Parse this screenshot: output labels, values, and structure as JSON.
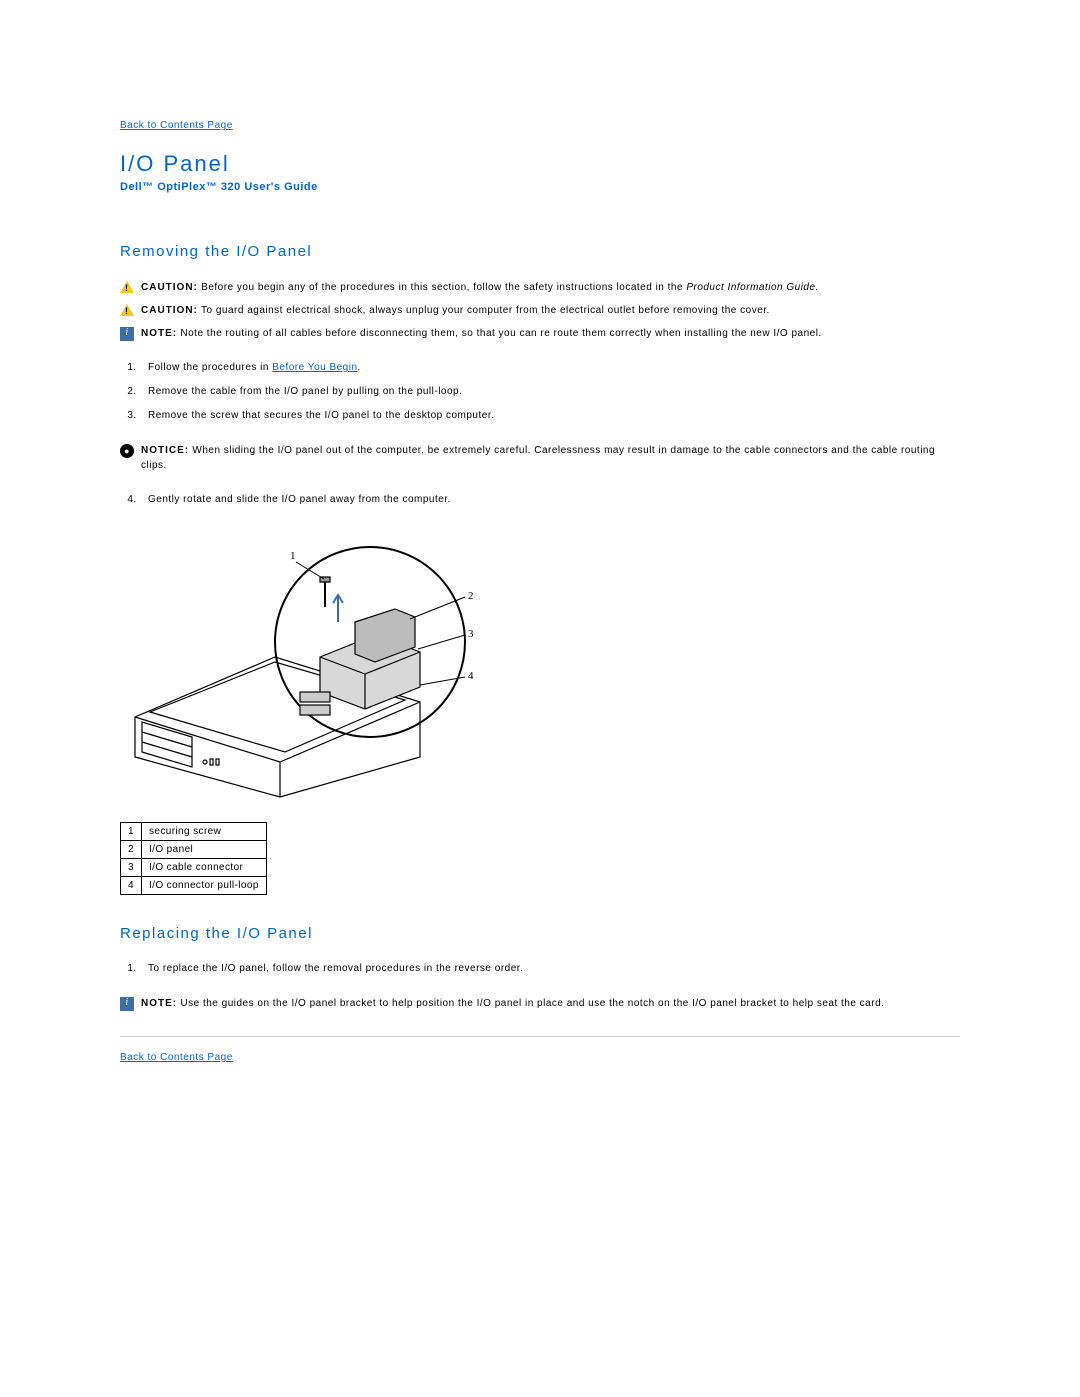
{
  "nav": {
    "back_top": "Back to Contents Page",
    "back_bottom": "Back to Contents Page"
  },
  "title": "I/O Panel",
  "subtitle": "Dell™ OptiPlex™ 320 User's Guide",
  "section1": {
    "heading": "Removing the I/O Panel",
    "caution1_label": "CAUTION:",
    "caution1_text": "Before you begin any of the procedures in this section, follow the safety instructions located in the ",
    "caution1_italic": "Product Information Guide.",
    "caution2_label": "CAUTION:",
    "caution2_text": "To guard against electrical shock, always unplug your computer from the electrical outlet before removing the cover.",
    "note1_label": "NOTE:",
    "note1_text": "Note the routing of all cables before disconnecting them, so that you can re route them correctly when installing the new I/O panel.",
    "step1_a": "Follow the procedures in ",
    "step1_link": "Before You Begin",
    "step1_b": ".",
    "step2": "Remove the cable from the I/O panel by pulling on the pull-loop.",
    "step3": "Remove the screw that secures the I/O panel to the desktop computer.",
    "notice_label": "NOTICE:",
    "notice_text": "When sliding the I/O panel out of the computer, be extremely careful. Carelessness may result in damage to the cable connectors and the cable routing clips.",
    "step4": "Gently rotate and slide the I/O panel away from the computer.",
    "legend": [
      {
        "n": "1",
        "label": "securing screw"
      },
      {
        "n": "2",
        "label": "I/O panel"
      },
      {
        "n": "3",
        "label": "I/O cable connector"
      },
      {
        "n": "4",
        "label": "I/O connector pull-loop"
      }
    ]
  },
  "section2": {
    "heading": "Replacing the I/O Panel",
    "step1": "To replace the I/O panel, follow the removal procedures in the reverse order.",
    "note_label": "NOTE:",
    "note_text": "Use the guides on the I/O panel bracket to help position the I/O panel in place and use the notch on the I/O panel bracket to help seat the card."
  }
}
